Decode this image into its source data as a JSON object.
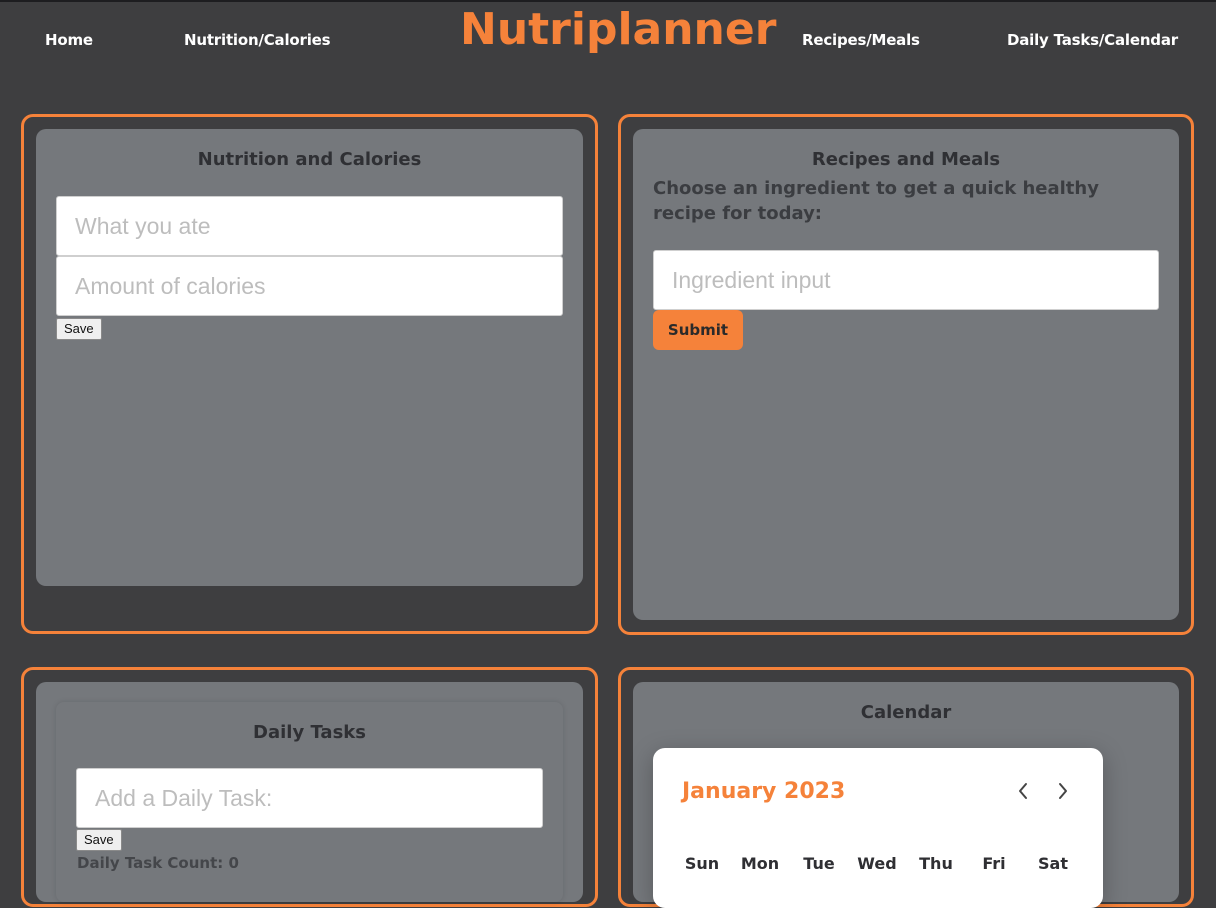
{
  "header": {
    "logo": "Nutriplanner",
    "nav": [
      "Home",
      "Nutrition/Calories",
      "Recipes/Meals",
      "Daily Tasks/Calendar"
    ]
  },
  "nutrition": {
    "title": "Nutrition and Calories",
    "food_placeholder": "What you ate",
    "calories_placeholder": "Amount of calories",
    "save_label": "Save"
  },
  "recipes": {
    "title": "Recipes and Meals",
    "prompt": "Choose an ingredient to get a quick healthy recipe for today:",
    "ingredient_placeholder": "Ingredient input",
    "submit_label": "Submit"
  },
  "tasks": {
    "title": "Daily Tasks",
    "task_placeholder": "Add a Daily Task:",
    "save_label": "Save",
    "count_label": "Daily Task Count: 0"
  },
  "calendar": {
    "title": "Calendar",
    "month": "January 2023",
    "weekdays": [
      "Sun",
      "Mon",
      "Tue",
      "Wed",
      "Thu",
      "Fri",
      "Sat"
    ]
  },
  "colors": {
    "accent": "#f5823a",
    "background": "#3e3e40",
    "card": "#75787c"
  },
  "icons": {
    "prev": "chevron-left-icon",
    "next": "chevron-right-icon"
  }
}
